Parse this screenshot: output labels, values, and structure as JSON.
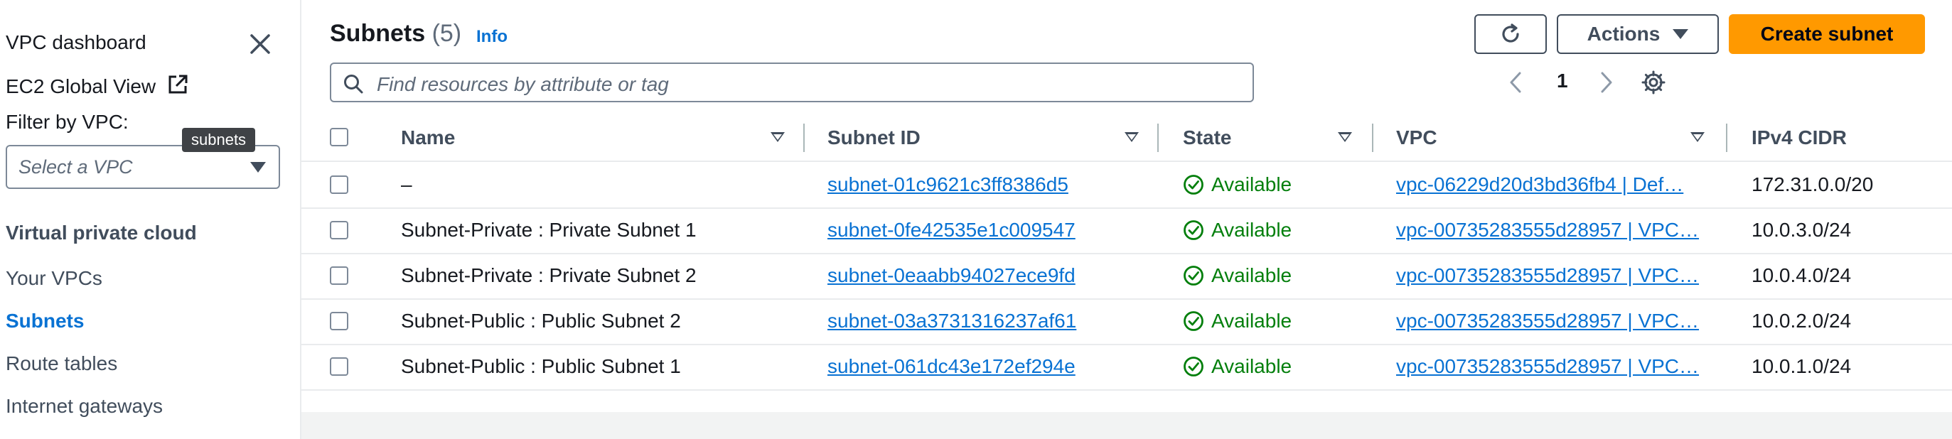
{
  "sidebar": {
    "dashboard": "VPC dashboard",
    "global_view": "EC2 Global View",
    "filter_label": "Filter by VPC:",
    "select_placeholder": "Select a VPC",
    "tooltip": "subnets",
    "section_title": "Virtual private cloud",
    "items": [
      {
        "label": "Your VPCs",
        "active": false
      },
      {
        "label": "Subnets",
        "active": true
      },
      {
        "label": "Route tables",
        "active": false
      },
      {
        "label": "Internet gateways",
        "active": false
      }
    ]
  },
  "header": {
    "title": "Subnets",
    "count": "(5)",
    "info": "Info",
    "actions_label": "Actions",
    "create_label": "Create subnet"
  },
  "search": {
    "placeholder": "Find resources by attribute or tag"
  },
  "pagination": {
    "current_page": "1"
  },
  "table": {
    "columns": [
      "Name",
      "Subnet ID",
      "State",
      "VPC",
      "IPv4 CIDR"
    ],
    "rows": [
      {
        "name": "–",
        "subnet_id": "subnet-01c9621c3ff8386d5",
        "state": "Available",
        "vpc": "vpc-06229d20d3bd36fb4 | Def…",
        "cidr": "172.31.0.0/20"
      },
      {
        "name": "Subnet-Private : Private Subnet 1",
        "subnet_id": "subnet-0fe42535e1c009547",
        "state": "Available",
        "vpc": "vpc-00735283555d28957 | VPC…",
        "cidr": "10.0.3.0/24"
      },
      {
        "name": "Subnet-Private : Private Subnet 2",
        "subnet_id": "subnet-0eaabb94027ece9fd",
        "state": "Available",
        "vpc": "vpc-00735283555d28957 | VPC…",
        "cidr": "10.0.4.0/24"
      },
      {
        "name": "Subnet-Public : Public Subnet 2",
        "subnet_id": "subnet-03a3731316237af61",
        "state": "Available",
        "vpc": "vpc-00735283555d28957 | VPC…",
        "cidr": "10.0.2.0/24"
      },
      {
        "name": "Subnet-Public : Public Subnet 1",
        "subnet_id": "subnet-061dc43e172ef294e",
        "state": "Available",
        "vpc": "vpc-00735283555d28957 | VPC…",
        "cidr": "10.0.1.0/24"
      }
    ]
  },
  "colors": {
    "link": "#0972d3",
    "primary_button": "#ff9900",
    "success": "#037f0c"
  }
}
